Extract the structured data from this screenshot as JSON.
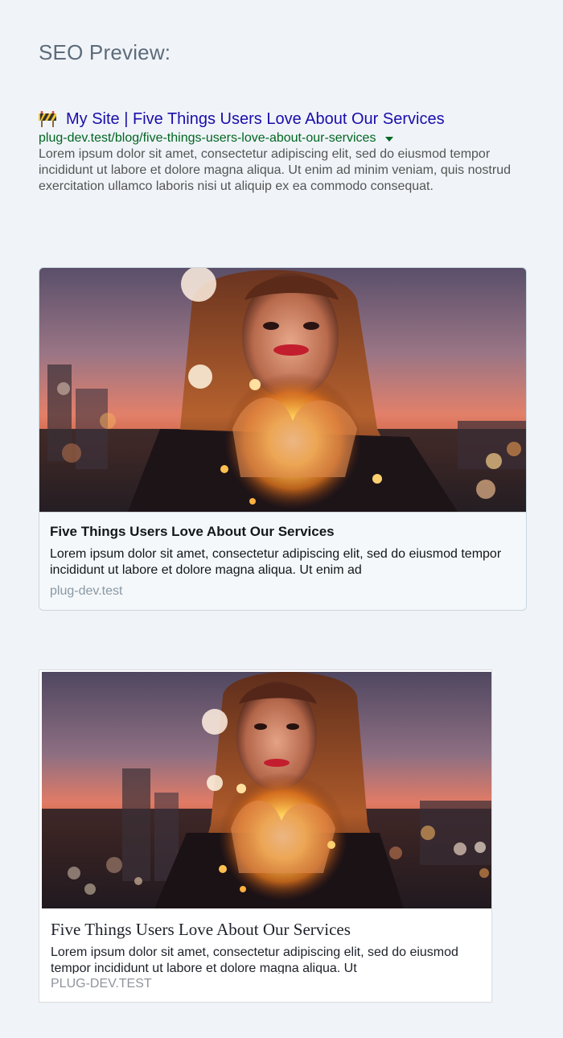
{
  "page": {
    "heading": "SEO Preview:"
  },
  "google": {
    "favicon": "construction-sign-icon",
    "title": "My Site | Five Things Users Love About Our Services",
    "url": "plug-dev.test/blog/five-things-users-love-about-our-services",
    "description": "Lorem ipsum dolor sit amet, consectetur adipiscing elit, sed do eiusmod tempor incididunt ut labore et dolore magna aliqua. Ut enim ad minim veniam, quis nostrud exercitation ullamco laboris nisi ut aliquip ex ea commodo consequat."
  },
  "twitter": {
    "image": "woman-holding-fairy-lights-photo",
    "title": "Five Things Users Love About Our Services",
    "description": "Lorem ipsum dolor sit amet, consectetur adipiscing elit, sed do eiusmod tempor incididunt ut labore et dolore magna aliqua. Ut enim ad",
    "domain": "plug-dev.test"
  },
  "facebook": {
    "image": "woman-holding-fairy-lights-photo",
    "title": "Five Things Users Love About Our Services",
    "description": "Lorem ipsum dolor sit amet, consectetur adipiscing elit, sed do eiusmod tempor incididunt ut labore et dolore magna aliqua. Ut",
    "domain": "plug-dev.test"
  },
  "colors": {
    "background": "#f0f4f8",
    "google_title": "#1a0dab",
    "google_url": "#006621",
    "google_text": "#545454"
  }
}
